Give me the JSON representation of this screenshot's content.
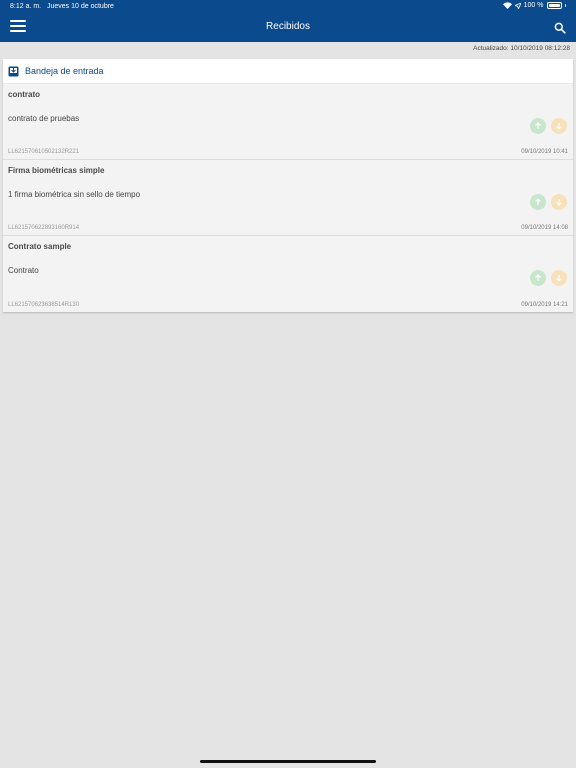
{
  "status_bar": {
    "time": "8:12 a. m.",
    "date": "Jueves 10 de octubre",
    "battery": "100 %",
    "battery_level": 1.0
  },
  "header": {
    "title": "Recibidos",
    "menu_icon": "hamburger-menu-icon",
    "search_icon": "search-icon",
    "background_color": "#0b4a8c"
  },
  "updated": "Actualizado: 10/10/2019 08:12:28",
  "inbox": {
    "title": "Bandeja de entrada",
    "icon": "inbox-icon"
  },
  "documents": [
    {
      "title": "contrato",
      "description": "contrato de pruebas",
      "code": "LL621570610502132R221",
      "date": "09/10/2019 10:41"
    },
    {
      "title": "Firma biométricas simple",
      "description": "1 firma biométrica sin sello de tiempo",
      "code": "LL621570622893160R914",
      "date": "09/10/2019 14:08"
    },
    {
      "title": "Contrato sample",
      "description": "Contrato",
      "code": "LL621570623638514R130",
      "date": "09/10/2019 14:21"
    }
  ],
  "colors": {
    "accept": "#c7e6cc",
    "reject": "#f8e0b8"
  }
}
